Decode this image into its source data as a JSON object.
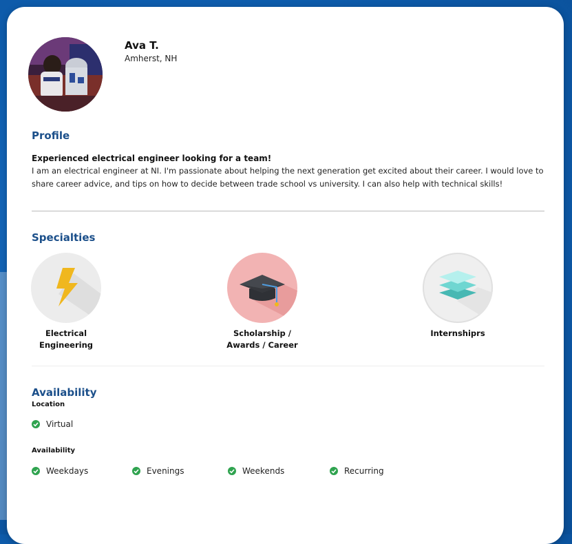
{
  "profile_card": {
    "name": "Ava T.",
    "location": "Amherst, NH"
  },
  "profile": {
    "section_title": "Profile",
    "headline": "Experienced electrical engineer looking for a team!",
    "bio": "I am an electrical engineer at NI. I'm passionate about helping the next generation get excited about their career. I would love to share career advice, and tips on how to decide between trade school vs university. I can also help with technical skills!"
  },
  "specialties": {
    "section_title": "Specialties",
    "items": [
      {
        "label_line1": "Electrical",
        "label_line2": "Engineering",
        "icon": "lightning-bolt-icon",
        "bg_color": "#ececec",
        "icon_color": "#f0b71e"
      },
      {
        "label_line1": "Scholarship /",
        "label_line2": "Awards / Career",
        "icon": "graduation-cap-icon",
        "bg_color": "#f2b3b3",
        "icon_color": "#3d3f44"
      },
      {
        "label_line1": "Internshiprs",
        "label_line2": "",
        "icon": "layers-stack-icon",
        "bg_color": "#efefef",
        "icon_color": "#5fd3cf"
      }
    ]
  },
  "availability": {
    "section_title": "Availability",
    "location_label": "Location",
    "location_options": [
      "Virtual"
    ],
    "availability_label": "Availability",
    "availability_options": [
      "Weekdays",
      "Evenings",
      "Weekends",
      "Recurring"
    ],
    "check_color": "#2fa34f"
  },
  "colors": {
    "section_title": "#1b4f8a",
    "background": "#0f5fb0"
  }
}
